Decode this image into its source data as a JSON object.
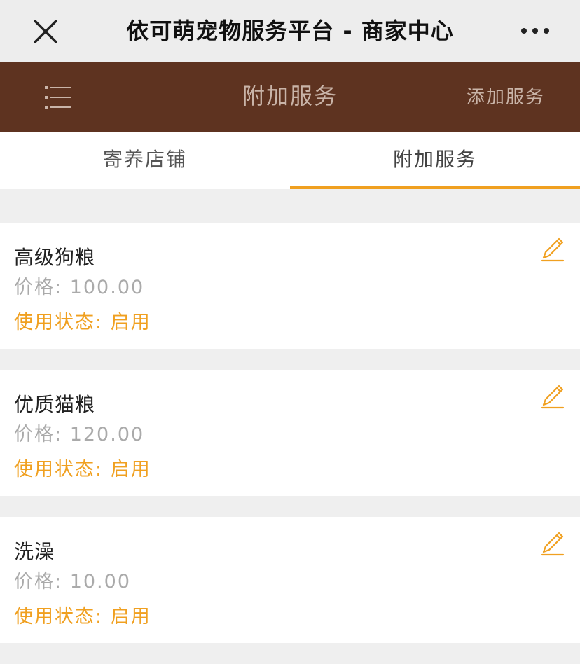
{
  "window": {
    "title": "依可萌宠物服务平台 - 商家中心"
  },
  "header": {
    "title": "附加服务",
    "add_label": "添加服务"
  },
  "tabs": [
    {
      "label": "寄养店铺",
      "active": false
    },
    {
      "label": "附加服务",
      "active": true
    }
  ],
  "services": [
    {
      "name": "高级狗粮",
      "price_label": "价格:",
      "price": "100.00",
      "status_label": "使用状态:",
      "status": "启用"
    },
    {
      "name": "优质猫粮",
      "price_label": "价格:",
      "price": "120.00",
      "status_label": "使用状态:",
      "status": "启用"
    },
    {
      "name": "洗澡",
      "price_label": "价格:",
      "price": "10.00",
      "status_label": "使用状态:",
      "status": "启用"
    }
  ],
  "colors": {
    "header_bg": "#5e3320",
    "accent": "#f0a020"
  },
  "icons": {
    "close": "close-icon",
    "more": "more-icon",
    "menu": "menu-icon",
    "edit": "edit-icon"
  }
}
